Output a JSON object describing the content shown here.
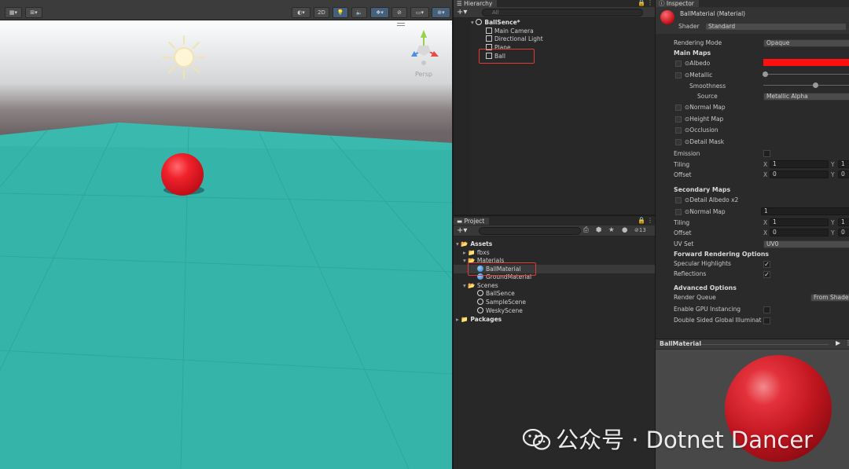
{
  "scene": {
    "toolbar": {
      "btn_2d": "2D"
    },
    "persp_label": "Persp"
  },
  "hierarchy": {
    "tab_label": "Hierarchy",
    "search_placeholder": "All",
    "items": [
      {
        "label": "BallSence*"
      },
      {
        "label": "Main Camera"
      },
      {
        "label": "Directional Light"
      },
      {
        "label": "Plane"
      },
      {
        "label": "Ball"
      }
    ]
  },
  "project": {
    "tab_label": "Project",
    "hidden_count": "13",
    "items": [
      {
        "label": "Assets"
      },
      {
        "label": "fbxs"
      },
      {
        "label": "Materials"
      },
      {
        "label": "BallMaterial"
      },
      {
        "label": "GroundMaterial"
      },
      {
        "label": "Scenes"
      },
      {
        "label": "BallSence"
      },
      {
        "label": "SampleScene"
      },
      {
        "label": "WeskyScene"
      },
      {
        "label": "Packages"
      }
    ]
  },
  "inspector": {
    "tab_label": "Inspector",
    "material_name": "BallMaterial (Material)",
    "shader_label": "Shader",
    "shader_value": "Standard",
    "rendering_mode_label": "Rendering Mode",
    "rendering_mode_value": "Opaque",
    "main_maps": "Main Maps",
    "albedo": "Albedo",
    "albedo_color": "#ff1010",
    "metallic": "Metallic",
    "smoothness": "Smoothness",
    "source_label": "Source",
    "source_value": "Metallic Alpha",
    "normal_map": "Normal Map",
    "height_map": "Height Map",
    "occlusion": "Occlusion",
    "detail_mask": "Detail Mask",
    "emission": "Emission",
    "tiling": "Tiling",
    "offset": "Offset",
    "x": "X",
    "y": "Y",
    "tiling_x": "1",
    "tiling_y": "1",
    "offset_x": "0",
    "offset_y": "0",
    "secondary_maps": "Secondary Maps",
    "detail_albedo": "Detail Albedo x2",
    "normal_map_2": "Normal Map",
    "normal_map_2_value": "1",
    "tiling_2_x": "1",
    "tiling_2_y": "1",
    "offset_2_x": "0",
    "offset_2_y": "0",
    "uv_set_label": "UV Set",
    "uv_set_value": "UV0",
    "forward_options": "Forward Rendering Options",
    "specular_highlights": "Specular Highlights",
    "reflections": "Reflections",
    "advanced_options": "Advanced Options",
    "render_queue": "Render Queue",
    "render_queue_value": "From Shader",
    "gpu_instancing": "Enable GPU Instancing",
    "double_sided": "Double Sided Global Illumination",
    "preview_title": "BallMaterial"
  },
  "watermark": {
    "text": "公众号 · Dotnet Dancer"
  }
}
